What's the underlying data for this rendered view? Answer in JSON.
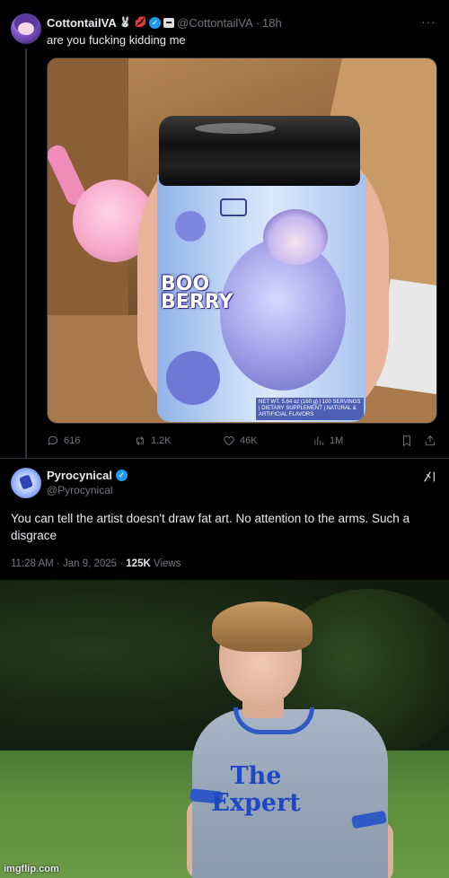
{
  "tweet1": {
    "display_name": "CottontailVA",
    "name_emojis": [
      "🐰",
      "💋"
    ],
    "handle": "@CottontailVA",
    "separator": "·",
    "time": "18h",
    "more": "···",
    "text": "are you fucking kidding me",
    "media": {
      "jar_brand": "BOO BERRY",
      "jar_label": "NET WT. 5.64 oz (160 g) | 100 SERVINGS | DIETARY SUPPLEMENT | NATURAL & ARTIFICIAL FLAVORS"
    },
    "actions": {
      "replies": "616",
      "reposts": "1.2K",
      "likes": "46K",
      "views": "1M"
    }
  },
  "tweet2": {
    "display_name": "Pyrocynical",
    "handle": "@Pyrocynical",
    "text": "You can tell the artist doesn't draw fat art. No attention to the arms. Such a disgrace",
    "time": "11:28 AM · Jan 9, 2025 · ",
    "views_count": "125K",
    "views_label": " Views"
  },
  "meme": {
    "shirt_line1": "The",
    "shirt_line2": "Expert",
    "watermark": "imgflip.com"
  },
  "colors": {
    "background": "#000000",
    "text_primary": "#e7e9ea",
    "text_secondary": "#71767b",
    "verified_blue": "#1d9bf0",
    "shirt_trim": "#2e59c7"
  }
}
